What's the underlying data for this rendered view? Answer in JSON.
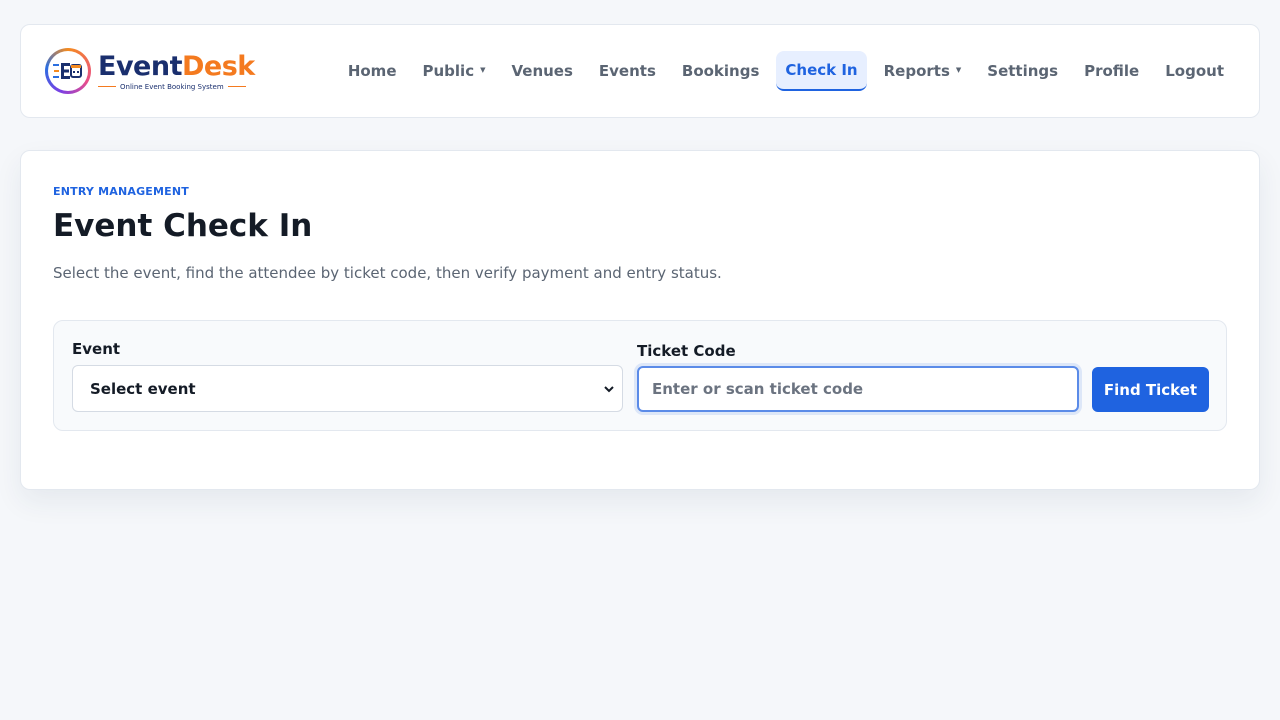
{
  "brand": {
    "name_part1": "Event",
    "name_part2": "Desk",
    "tagline": "Online Event Booking System",
    "logo_letters": "ED"
  },
  "nav": {
    "items": [
      {
        "label": "Home",
        "dropdown": false,
        "active": false
      },
      {
        "label": "Public",
        "dropdown": true,
        "active": false
      },
      {
        "label": "Venues",
        "dropdown": false,
        "active": false
      },
      {
        "label": "Events",
        "dropdown": false,
        "active": false
      },
      {
        "label": "Bookings",
        "dropdown": false,
        "active": false
      },
      {
        "label": "Check In",
        "dropdown": false,
        "active": true
      },
      {
        "label": "Reports",
        "dropdown": true,
        "active": false
      },
      {
        "label": "Settings",
        "dropdown": false,
        "active": false
      },
      {
        "label": "Profile",
        "dropdown": false,
        "active": false
      },
      {
        "label": "Logout",
        "dropdown": false,
        "active": false
      }
    ]
  },
  "page": {
    "eyebrow": "ENTRY MANAGEMENT",
    "title": "Event Check In",
    "description": "Select the event, find the attendee by ticket code, then verify payment and entry status."
  },
  "form": {
    "event_label": "Event",
    "event_selected": "Select event",
    "ticket_label": "Ticket Code",
    "ticket_value": "",
    "ticket_placeholder": "Enter or scan ticket code",
    "submit_label": "Find Ticket"
  },
  "colors": {
    "accent": "#1f63e0",
    "brand_navy": "#1a2f6e",
    "brand_orange": "#f47a1f",
    "background": "#f5f7fa"
  },
  "icons": {
    "logo": "event-desk-logo-icon",
    "dropdown": "caret-down-icon",
    "select_chevron": "chevron-down-icon"
  }
}
